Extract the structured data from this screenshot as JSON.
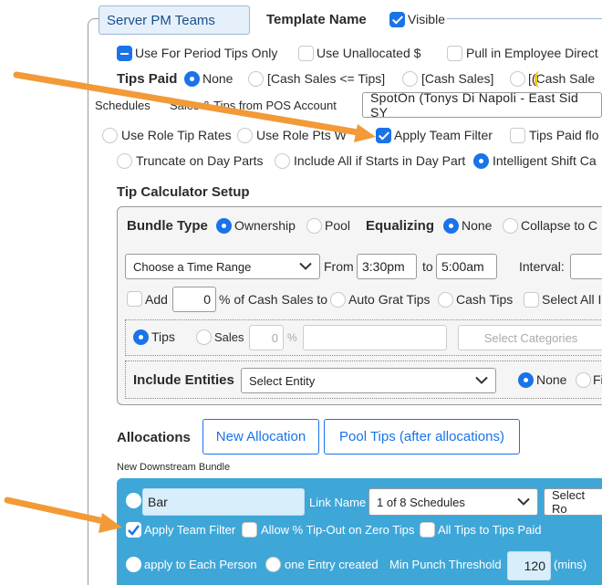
{
  "header": {
    "template_name_value": "Server PM Teams",
    "template_name_label": "Template Name",
    "visible_label": "Visible"
  },
  "row_period": {
    "period_tips_only": "Use For Period Tips Only",
    "use_unallocated": "Use Unallocated $",
    "pull_employee": "Pull in Employee Direct"
  },
  "tips_paid": {
    "label": "Tips Paid",
    "none": "None",
    "cash_sales_le_tips": "[Cash Sales <= Tips]",
    "cash_sales": "[Cash Sales]",
    "cash_sale_cut": "[(Cash Sale"
  },
  "schedules": {
    "label": "Schedules",
    "sales_tips_label": "Sales & Tips from POS Account",
    "pos_account_value": "SpotOn (Tonys Di Napoli - East Sid SY"
  },
  "row_roles": {
    "use_role_tip_rates": "Use Role Tip Rates",
    "use_role_pts": "Use Role Pts W",
    "apply_team_filter": "Apply Team Filter",
    "tips_paid_flow": "Tips Paid flo"
  },
  "row_dayparts": {
    "truncate_day_parts": "Truncate on Day Parts",
    "include_all_starts": "Include All if Starts in Day Part",
    "intelligent_shift": "Intelligent Shift Ca"
  },
  "tip_calc": {
    "title": "Tip Calculator Setup",
    "bundle_type_label": "Bundle Type",
    "ownership": "Ownership",
    "pool": "Pool",
    "equalizing_label": "Equalizing",
    "eq_none": "None",
    "collapse": "Collapse to C",
    "time_range_placeholder": "Choose a Time Range",
    "from_label": "From",
    "from_value": "3:30pm",
    "to_label": "to",
    "to_value": "5:00am",
    "interval_label": "Interval:",
    "add_label": "Add",
    "add_value": "0",
    "pct_cash_sales": "% of Cash Sales to",
    "auto_grat_tips": "Auto Grat Tips",
    "cash_tips": "Cash Tips",
    "select_all": "Select All I",
    "tips": "Tips",
    "sales": "Sales",
    "sales_pct_value": "0",
    "sales_pct_suffix": "%",
    "select_categories": "Select Categories",
    "include_entities_label": "Include Entities",
    "select_entity": "Select Entity",
    "ent_none": "None",
    "ent_f": "Fi"
  },
  "allocations": {
    "label": "Allocations",
    "new_allocation": "New Allocation",
    "pool_tips_after": "Pool Tips (after allocations)",
    "new_downstream_bundle": "New Downstream Bundle"
  },
  "bundle": {
    "name_value": "Bar",
    "link_name_label": "Link Name",
    "schedules_select": "1 of 8 Schedules",
    "select_ro": "Select Ro",
    "apply_team_filter": "Apply Team Filter",
    "allow_pct_tipout": "Allow % Tip-Out on Zero Tips",
    "all_tips_paid": "All Tips to Tips Paid",
    "apply_each_person": "apply to Each Person",
    "one_entry_created": "one Entry created",
    "min_punch_label": "Min Punch Threshold",
    "min_punch_value": "120",
    "mins_label": "(mins)"
  },
  "colors": {
    "accent": "#1a73e8",
    "bundle_bg": "#3ea7d8",
    "arrow": "#f29a38",
    "highlight_yellow": "#f5c518"
  },
  "icons": [
    "checkbox-icon",
    "radio-icon",
    "chevron-down-icon",
    "arrow-annotation-icon"
  ]
}
